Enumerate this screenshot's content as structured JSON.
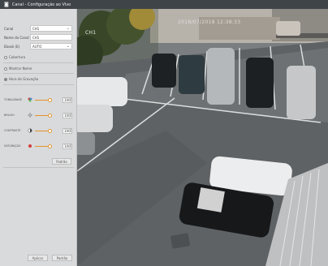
{
  "window": {
    "title": "Canal - Configuração ao Vivo"
  },
  "panel": {
    "canal": {
      "label": "Canal",
      "value": "CH1"
    },
    "nome": {
      "label": "Nome do Canal",
      "value": "CH1"
    },
    "ebook": {
      "label": "Ebook (E)",
      "value": "AUTO"
    },
    "cobertura": {
      "label": "Cobertura"
    },
    "mostrar_nome": {
      "label": "Mostrar Nome"
    },
    "hora": {
      "label": "Hora de Gravação"
    },
    "tonalidade": {
      "label": "TONALIDADE",
      "value": "100"
    },
    "brilho": {
      "label": "BRILHO",
      "value": "100"
    },
    "contraste": {
      "label": "CONTRASTE",
      "value": "100"
    },
    "saturacao": {
      "label": "SATURAÇÃO",
      "value": "100"
    },
    "padrao_label": "Padrão",
    "aplicar_label": "Aplicar",
    "padrao2_label": "Padrão"
  },
  "camera": {
    "osd_name": "CH1",
    "osd_time": "2018/07/2018 12:38:33"
  },
  "colors": {
    "accent": "#e39430",
    "title_bar": "#3f4449",
    "panel_bg": "#d9dadb"
  },
  "icons": [
    "camera-logo-icon",
    "chevron-down-icon",
    "hue-icon",
    "brightness-icon",
    "contrast-icon",
    "saturation-icon"
  ]
}
